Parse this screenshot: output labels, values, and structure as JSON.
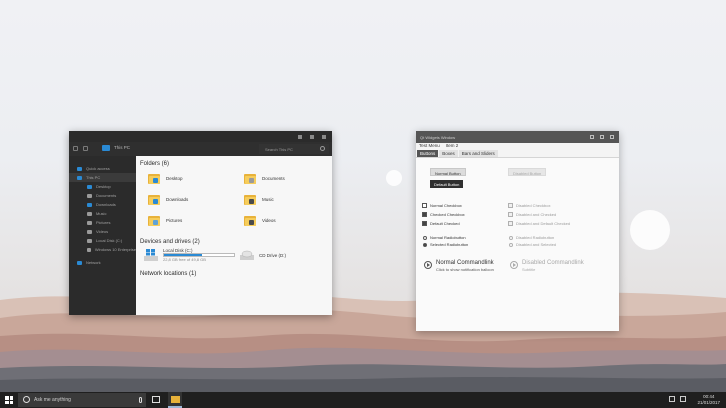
{
  "explorer": {
    "address": "This PC",
    "search_placeholder": "Search This PC",
    "sidebar": [
      {
        "label": "Quick access",
        "icon": "star-icon",
        "color": "#2a8ad4"
      },
      {
        "label": "This PC",
        "icon": "pc-icon",
        "color": "#2a8ad4",
        "selected": true
      },
      {
        "label": "Desktop",
        "icon": "desktop-icon",
        "color": "#2a8ad4"
      },
      {
        "label": "Documents",
        "icon": "documents-icon",
        "color": "#9a9a9a"
      },
      {
        "label": "Downloads",
        "icon": "downloads-icon",
        "color": "#2a8ad4"
      },
      {
        "label": "Music",
        "icon": "music-icon",
        "color": "#9a9a9a"
      },
      {
        "label": "Pictures",
        "icon": "pictures-icon",
        "color": "#9a9a9a"
      },
      {
        "label": "Videos",
        "icon": "videos-icon",
        "color": "#9a9a9a"
      },
      {
        "label": "Local Disk (C:)",
        "icon": "disk-icon",
        "color": "#9a9a9a"
      },
      {
        "label": "Windows 10 Enterprise",
        "icon": "dvd-icon",
        "color": "#9a9a9a"
      },
      {
        "label": "Network",
        "icon": "network-icon",
        "color": "#2a8ad4"
      }
    ],
    "folders_header": "Folders (6)",
    "folders": [
      {
        "label": "Desktop",
        "badge": "#2a8ad4"
      },
      {
        "label": "Documents",
        "badge": "#9a9a9a"
      },
      {
        "label": "Downloads",
        "badge": "#2a8ad4"
      },
      {
        "label": "Music",
        "badge": "#4a4a4a"
      },
      {
        "label": "Pictures",
        "badge": "#5fa3d8"
      },
      {
        "label": "Videos",
        "badge": "#4a4a4a"
      }
    ],
    "drives_header": "Devices and drives (2)",
    "drive_c": {
      "label": "Local Disk (C:)",
      "free": "22,8 GB free of 49,8 GB",
      "used_fraction": 0.54
    },
    "drive_d": {
      "label": "CD Drive (D:)"
    },
    "network_header": "Network locations (1)"
  },
  "qt": {
    "title": "Qt Widgets Window",
    "menu": [
      "Test Menu",
      "Item 2"
    ],
    "tabs": [
      "Buttons",
      "Boxes",
      "Bars and Sliders"
    ],
    "normal_button": "Normal Button",
    "default_button": "Default Button",
    "disabled_button": "Disabled Button",
    "checkboxes": [
      "Normal Checkbox",
      "Checked Checkbox",
      "Default Checked"
    ],
    "checkboxes_disabled": [
      "Disabled Checkbox",
      "Disabled and Checked",
      "Disabled and Default Checked"
    ],
    "radios": [
      "Normal Radiobutton",
      "Selected Radiobutton"
    ],
    "radios_disabled": [
      "Disabled Radiobutton",
      "Disabled and Selected"
    ],
    "cmdlink_title": "Normal Commandlink",
    "cmdlink_desc": "Click to show notification balloon",
    "cmdlink_dis_title": "Disabled Commandlink",
    "cmdlink_dis_desc": "Subtitle"
  },
  "taskbar": {
    "search_placeholder": "Ask me anything",
    "time": "00:44",
    "date": "21/01/2017"
  }
}
